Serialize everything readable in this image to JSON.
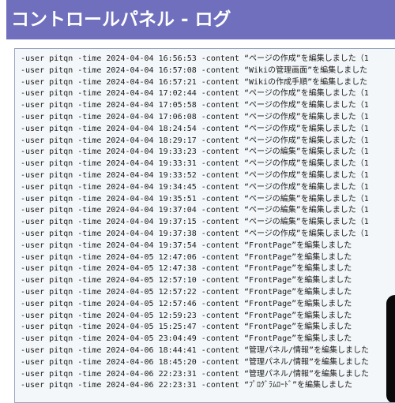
{
  "header": {
    "title": "コントロールパネル - ログ"
  },
  "log": {
    "lines": [
      "-user pitqn -time 2024-04-04 16:56:53 -content “ページの作成”を編集しました（1",
      "-user pitqn -time 2024-04-04 16:57:08 -content “Wikiの管理画面”を編集しました",
      "-user pitqn -time 2024-04-04 16:57:21 -content “Wikiの作成手順”を編集しました",
      "-user pitqn -time 2024-04-04 17:02:44 -content “ページの作成”を編集しました（1",
      "-user pitqn -time 2024-04-04 17:05:58 -content “ページの作成”を編集しました（1",
      "-user pitqn -time 2024-04-04 17:06:08 -content “ページの作成”を編集しました（1",
      "-user pitqn -time 2024-04-04 18:24:54 -content “ページの作成”を編集しました（1",
      "-user pitqn -time 2024-04-04 18:29:17 -content “ページの作成”を編集しました（1",
      "-user pitqn -time 2024-04-04 19:33:23 -content “ページの編集”を編集しました（1",
      "-user pitqn -time 2024-04-04 19:33:31 -content “ページの作成”を編集しました（1",
      "-user pitqn -time 2024-04-04 19:33:52 -content “ページの作成”を編集しました（1",
      "-user pitqn -time 2024-04-04 19:34:45 -content “ページの作成”を編集しました（1",
      "-user pitqn -time 2024-04-04 19:35:51 -content “ページの編集”を編集しました（1",
      "-user pitqn -time 2024-04-04 19:37:04 -content “ページの編集”を編集しました（1",
      "-user pitqn -time 2024-04-04 19:37:15 -content “ページの編集”を編集しました（1",
      "-user pitqn -time 2024-04-04 19:37:38 -content “ページの作成”を編集しました（1",
      "-user pitqn -time 2024-04-04 19:37:54 -content “FrontPage”を編集しました",
      "-user pitqn -time 2024-04-05 12:47:06 -content “FrontPage”を編集しました",
      "-user pitqn -time 2024-04-05 12:47:38 -content “FrontPage”を編集しました",
      "-user pitqn -time 2024-04-05 12:57:10 -content “FrontPage”を編集しました",
      "-user pitqn -time 2024-04-05 12:57:22 -content “FrontPage”を編集しました",
      "-user pitqn -time 2024-04-05 12:57:46 -content “FrontPage”を編集しました",
      "-user pitqn -time 2024-04-05 12:59:23 -content “FrontPage”を編集しました",
      "-user pitqn -time 2024-04-05 15:25:47 -content “FrontPage”を編集しました",
      "-user pitqn -time 2024-04-05 23:04:49 -content “FrontPage”を編集しました",
      "-user pitqn -time 2024-04-06 18:44:41 -content “管理パネル/情報”を編集しました",
      "-user pitqn -time 2024-04-06 18:45:20 -content “管理パネル/情報”を編集しました",
      "-user pitqn -time 2024-04-06 22:23:31 -content “管理パネル/情報”を編集しました",
      "-user pitqn -time 2024-04-06 22:23:31 -content “ﾌﾟﾛｸﾞﾗﾑﾛｰﾄﾞ”を編集しました"
    ]
  }
}
